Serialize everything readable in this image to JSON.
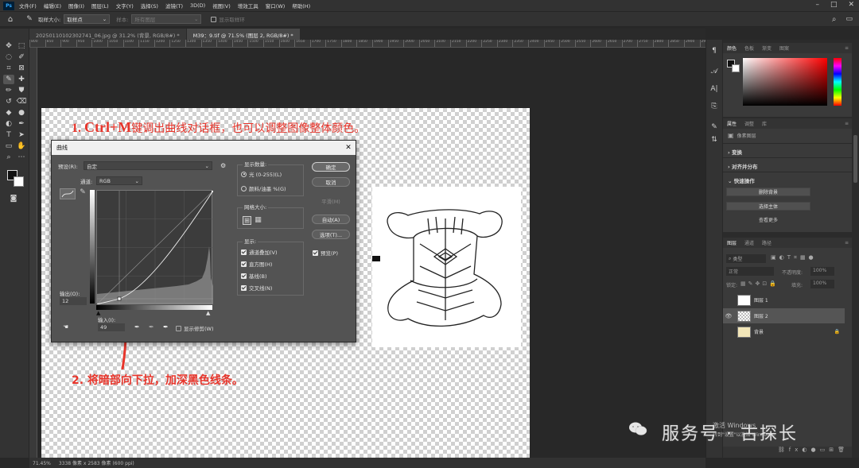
{
  "menubar": {
    "logo": "Ps",
    "items": [
      "文件(F)",
      "编辑(E)",
      "图像(I)",
      "图层(L)",
      "文字(Y)",
      "选择(S)",
      "滤镜(T)",
      "3D(D)",
      "视图(V)",
      "增效工具",
      "窗口(W)",
      "帮助(H)"
    ]
  },
  "options": {
    "sample_size_label": "取样大小:",
    "sample_size_value": "取样点",
    "sample_label": "样本:",
    "sample_value": "所有图层",
    "ring_label": "显示取样环"
  },
  "tabs": [
    {
      "label": "20250110102302741_06.jpg @ 31.2% (背景, RGB/8#) *"
    },
    {
      "label": "M39：9.tif @ 71.5% (图层 2, RGB/8#) *"
    }
  ],
  "ruler": [
    "800",
    "850",
    "900",
    "950",
    "1000",
    "1050",
    "1100",
    "1150",
    "1200",
    "1250",
    "1300",
    "1350",
    "1400",
    "1450",
    "1500",
    "1550",
    "1600",
    "1650",
    "1700",
    "1750",
    "1800",
    "1850",
    "1900",
    "1950",
    "2000",
    "2050",
    "2100",
    "2150",
    "2200",
    "2250",
    "2300",
    "2350",
    "2400",
    "2450",
    "2500",
    "2550",
    "2600",
    "2650",
    "2700",
    "2750",
    "2800",
    "2850",
    "2900",
    "2950",
    "3000"
  ],
  "annotations": {
    "step1_prefix": "1. ",
    "step1_key": "Ctrl+M",
    "step1_text": "键调出曲线对话框，也可以调整图像整体颜色。",
    "step2": "2. 将暗部向下拉，加深黑色线条。"
  },
  "curves_dialog": {
    "title": "曲线",
    "preset_label": "预设(R):",
    "preset_value": "自定",
    "channel_label": "通道:",
    "channel_value": "RGB",
    "output_label": "输出(O):",
    "output_value": "12",
    "input_label": "输入(I):",
    "input_value": "49",
    "show_clipping": "显示修剪(W)",
    "display_amount_label": "显示数量:",
    "light_option": "光 (0-255)(L)",
    "pigment_option": "颜料/油墨 %(G)",
    "grid_size_label": "网格大小:",
    "show_label": "显示:",
    "show_options": [
      "通道叠加(V)",
      "直方图(H)",
      "基线(B)",
      "交叉线(N)"
    ],
    "buttons": {
      "ok": "确定",
      "cancel": "取消",
      "smooth": "平滑(M)",
      "auto": "自动(A)",
      "options": "选项(T)..."
    },
    "preview": "预览(P)"
  },
  "right_panels": {
    "color_tabs": [
      "颜色",
      "色板",
      "渐变",
      "图案"
    ],
    "props_tabs": [
      "属性",
      "调整",
      "库"
    ],
    "pixel_layer": "像素图层",
    "transform": "变换",
    "align": "对齐并分布",
    "quick_actions": "快速操作",
    "qa_buttons": [
      "删除背景",
      "选择主体"
    ],
    "qa_more": "查看更多",
    "layers_tabs": [
      "图层",
      "通道",
      "路径"
    ],
    "kind_label": "类型",
    "blend_mode": "正常",
    "opacity_label": "不透明度:",
    "opacity_value": "100%",
    "lock_label": "锁定:",
    "fill_label": "填充:",
    "fill_value": "100%",
    "layers": [
      {
        "name": "图层 1"
      },
      {
        "name": "图层 2"
      },
      {
        "name": "背景"
      }
    ]
  },
  "watermark": {
    "activate": "激活 Windows",
    "activate_sub": "转到\"设置\"以激活 Windows。",
    "brand": "服务号 · 古探长"
  },
  "status": {
    "zoom": "71.45%",
    "size": "3338 像素 x 2583 像素 (600 ppi)"
  }
}
